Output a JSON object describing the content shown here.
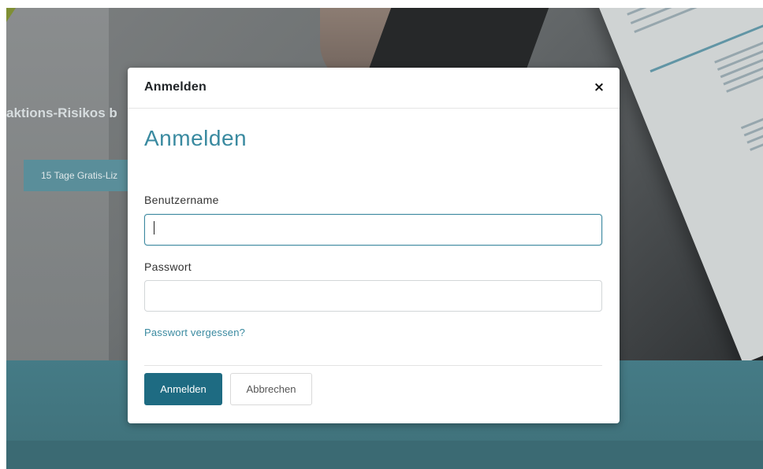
{
  "background": {
    "hero_title": "aktions-Risikos b",
    "cta_label": "15 Tage Gratis-Liz",
    "accent_color": "#457b86"
  },
  "modal": {
    "header_title": "Anmelden",
    "close_label": "×",
    "heading": "Anmelden",
    "username_label": "Benutzername",
    "username_value": "",
    "password_label": "Passwort",
    "password_value": "",
    "forgot_link": "Passwort vergessen?",
    "submit_label": "Anmelden",
    "cancel_label": "Abbrechen",
    "primary_color": "#1e6b82",
    "heading_color": "#3a8aa0"
  }
}
